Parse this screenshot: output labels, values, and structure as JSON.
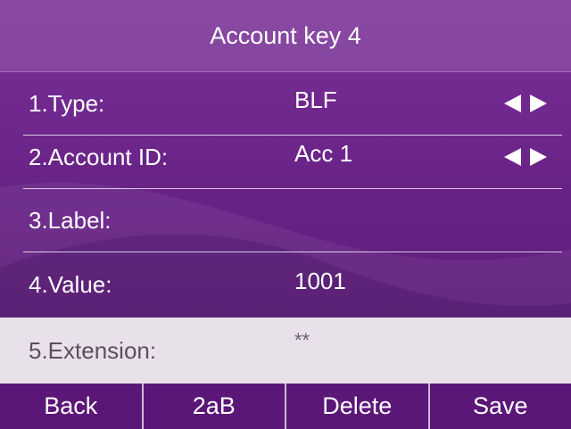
{
  "header": {
    "title": "Account key 4"
  },
  "rows": [
    {
      "label": "1.Type:",
      "value": "BLF",
      "arrows_icon": "left-right-arrows-icon"
    },
    {
      "label": "2.Account ID:",
      "value": "Acc 1",
      "arrows_icon": "left-right-arrows-icon"
    },
    {
      "label": "3.Label:",
      "value": ""
    },
    {
      "label": "4.Value:",
      "value": "1001"
    },
    {
      "label": "5.Extension:",
      "value": "**"
    }
  ],
  "softkeys": [
    "Back",
    "2aB",
    "Delete",
    "Save"
  ],
  "colors": {
    "background": "#6a2488",
    "selected_row": "#e8e1ea",
    "softkey_bar": "#5b1778",
    "text": "#ffffff"
  }
}
